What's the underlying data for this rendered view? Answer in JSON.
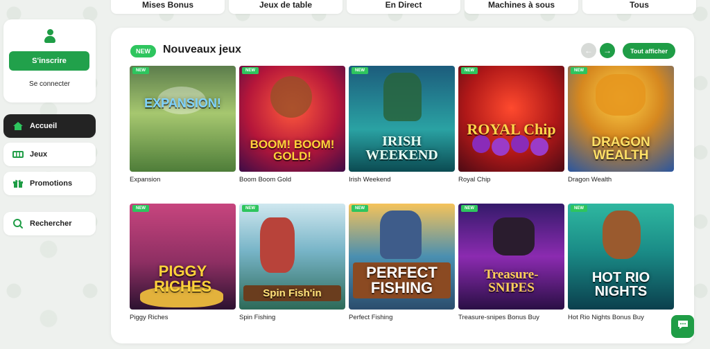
{
  "categories": [
    "Mises Bonus",
    "Jeux de table",
    "En Direct",
    "Machines à sous",
    "Tous"
  ],
  "auth": {
    "signup_label": "S'inscrire",
    "login_label": "Se connecter"
  },
  "nav": [
    {
      "label": "Accueil",
      "icon": "home-icon",
      "active": true
    },
    {
      "label": "Jeux",
      "icon": "slot-machine-icon",
      "active": false
    },
    {
      "label": "Promotions",
      "icon": "gift-icon",
      "active": false
    },
    {
      "label": "Rechercher",
      "icon": "search-icon",
      "active": false
    }
  ],
  "section": {
    "badge": "NEW",
    "title": "Nouveaux jeux",
    "see_all_label": "Tout afficher",
    "prev_icon": "arrow-left-icon",
    "next_icon": "arrow-right-icon"
  },
  "games": [
    {
      "name": "Expansion",
      "badge": "NEW",
      "logo": "EXPANSION!",
      "logo_color": "#7fd3ff"
    },
    {
      "name": "Boom Boom Gold",
      "badge": "NEW",
      "logo": "BOOM! BOOM! GOLD!",
      "logo_color": "#ffd23a"
    },
    {
      "name": "Irish Weekend",
      "badge": "NEW",
      "logo": "IRISH WEEKEND",
      "logo_color": "#e8fff5"
    },
    {
      "name": "Royal Chip",
      "badge": "NEW",
      "logo": "ROYAL Chip",
      "logo_color": "#ffd64a"
    },
    {
      "name": "Dragon Wealth",
      "badge": "NEW",
      "logo": "DRAGON WEALTH",
      "logo_color": "#ffe066"
    },
    {
      "name": "Piggy Riches",
      "badge": "NEW",
      "logo": "PIGGY RICHES",
      "logo_color": "#ffd23a"
    },
    {
      "name": "Spin Fishing",
      "badge": "NEW",
      "logo": "Spin Fish'in",
      "logo_color": "#ffe27a"
    },
    {
      "name": "Perfect Fishing",
      "badge": "NEW",
      "logo": "PERFECT FISHING",
      "logo_color": "#ffffff"
    },
    {
      "name": "Treasure-snipes Bonus Buy",
      "badge": "NEW",
      "logo": "Treasure-SNIPES",
      "logo_color": "#ffcf5a"
    },
    {
      "name": "Hot Rio Nights Bonus Buy",
      "badge": "NEW",
      "logo": "HOT RIO NIGHTS",
      "logo_color": "#ffffff"
    }
  ],
  "chat": {
    "icon": "chat-icon"
  },
  "colors": {
    "brand_green": "#1f9d46",
    "new_badge": "#2ec55e",
    "active_nav": "#232323"
  }
}
